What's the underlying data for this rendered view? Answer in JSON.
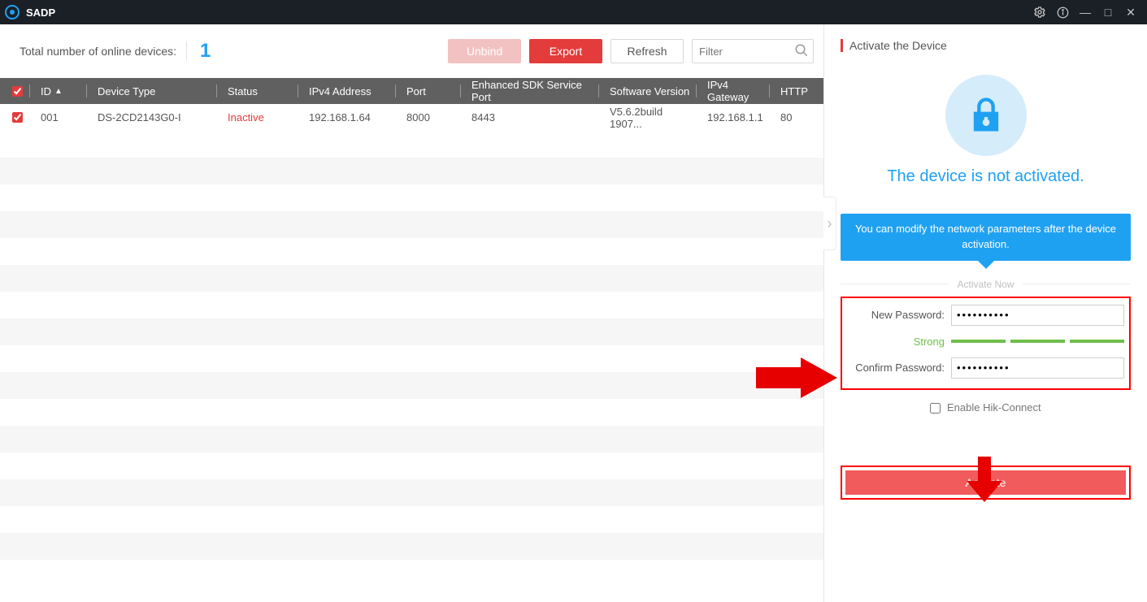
{
  "app": {
    "name": "SADP"
  },
  "toolbar": {
    "total_label": "Total number of online devices:",
    "total_count": "1",
    "unbind": "Unbind",
    "export": "Export",
    "refresh": "Refresh",
    "filter_placeholder": "Filter"
  },
  "columns": {
    "id": "ID",
    "type": "Device Type",
    "status": "Status",
    "ip": "IPv4 Address",
    "port": "Port",
    "sdk": "Enhanced SDK Service Port",
    "ver": "Software Version",
    "gw": "IPv4 Gateway",
    "http": "HTTP"
  },
  "rows": [
    {
      "id": "001",
      "type": "DS-2CD2143G0-I",
      "status": "Inactive",
      "ip": "192.168.1.64",
      "port": "8000",
      "sdk": "8443",
      "ver": "V5.6.2build 1907...",
      "gw": "192.168.1.1",
      "http": "80"
    }
  ],
  "panel": {
    "title": "Activate the Device",
    "not_activated": "The device is not activated.",
    "hint": "You can modify the network parameters after the device activation.",
    "activate_now": "Activate Now",
    "new_password_label": "New Password:",
    "new_password_value": "••••••••••",
    "strength_label": "Strong",
    "confirm_password_label": "Confirm Password:",
    "confirm_password_value": "••••••••••",
    "enable_hik": "Enable Hik-Connect",
    "activate_btn": "Activate"
  }
}
